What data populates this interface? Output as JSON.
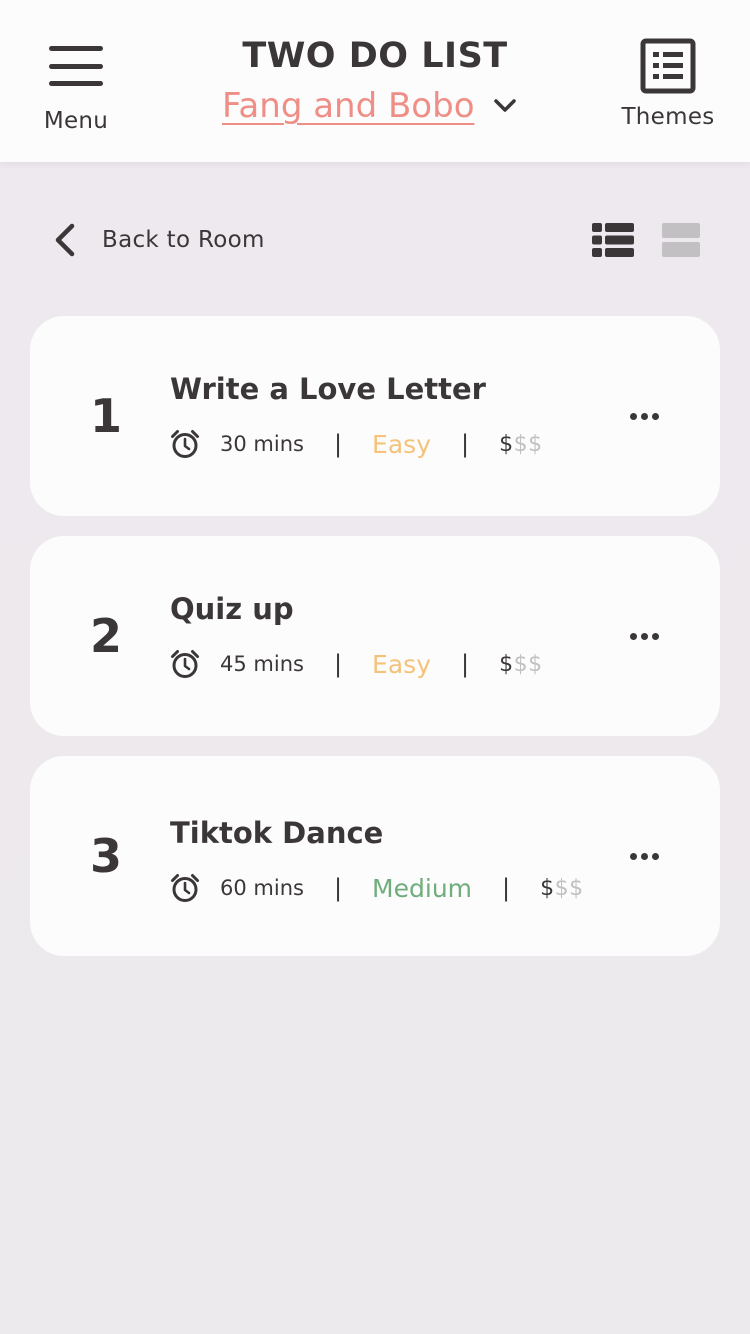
{
  "header": {
    "menu_label": "Menu",
    "title": "TWO DO LIST",
    "room_name": "Fang and Bobo",
    "themes_label": "Themes"
  },
  "toolbar": {
    "back_label": "Back to Room",
    "view_list_icon": "list-view-icon",
    "view_card_icon": "card-view-icon"
  },
  "colors": {
    "accent": "#ef8e86",
    "easy": "#f5c27a",
    "medium": "#6fae7c",
    "text": "#3b3738",
    "muted": "#c2c0c2"
  },
  "tasks": [
    {
      "number": "1",
      "title": "Write a Love Letter",
      "duration": "30 mins",
      "separator": "|",
      "difficulty": "Easy",
      "cost_filled": "$",
      "cost_empty": "$$"
    },
    {
      "number": "2",
      "title": "Quiz up",
      "duration": "45 mins",
      "separator": "|",
      "difficulty": "Easy",
      "cost_filled": "$",
      "cost_empty": "$$"
    },
    {
      "number": "3",
      "title": "Tiktok Dance",
      "duration": "60 mins",
      "separator": "|",
      "difficulty": "Medium",
      "cost_filled": "$",
      "cost_empty": "$$"
    }
  ]
}
